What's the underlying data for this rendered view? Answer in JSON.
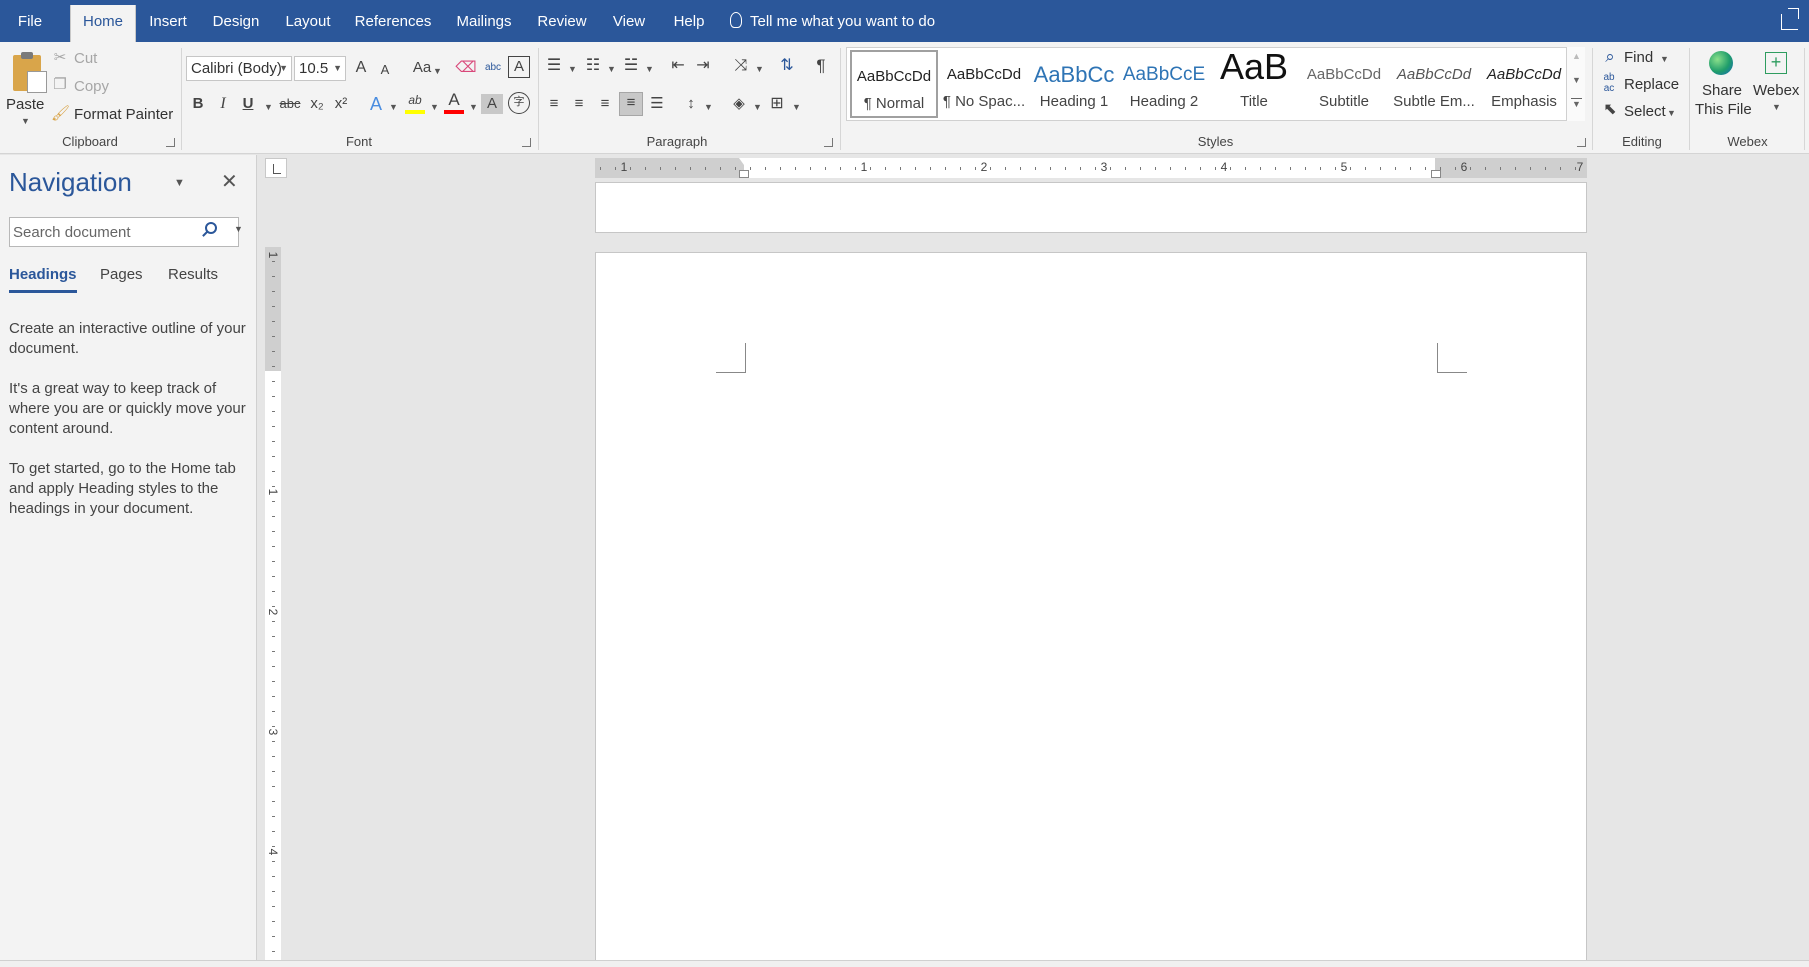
{
  "tabs": [
    "File",
    "Home",
    "Insert",
    "Design",
    "Layout",
    "References",
    "Mailings",
    "Review",
    "View",
    "Help"
  ],
  "active_tab": "Home",
  "tell_me": "Tell me what you want to do",
  "clipboard": {
    "paste": "Paste",
    "cut": "Cut",
    "copy": "Copy",
    "format_painter": "Format Painter",
    "label": "Clipboard"
  },
  "font": {
    "name": "Calibri (Body)",
    "size": "10.5",
    "label": "Font",
    "bold": "B",
    "italic": "I",
    "underline": "U",
    "strike": "abc",
    "sub": "x₂",
    "sup": "x²",
    "grow": "A",
    "shrink": "A",
    "change_case": "Aa",
    "effects": "A",
    "highlight": "ab",
    "font_color": "A",
    "shading": "A",
    "enclose": "字",
    "phonetic": "abc",
    "char_border": "A"
  },
  "paragraph": {
    "label": "Paragraph",
    "show_marks": "¶"
  },
  "styles": {
    "label": "Styles",
    "items": [
      {
        "preview": "AaBbCcDd",
        "name": "¶ Normal"
      },
      {
        "preview": "AaBbCcDd",
        "name": "¶ No Spac..."
      },
      {
        "preview": "AaBbCc",
        "name": "Heading 1"
      },
      {
        "preview": "AaBbCcE",
        "name": "Heading 2"
      },
      {
        "preview": "AaB",
        "name": "Title"
      },
      {
        "preview": "AaBbCcDd",
        "name": "Subtitle"
      },
      {
        "preview": "AaBbCcDd",
        "name": "Subtle Em..."
      },
      {
        "preview": "AaBbCcDd",
        "name": "Emphasis"
      }
    ]
  },
  "editing": {
    "find": "Find",
    "replace": "Replace",
    "select": "Select",
    "label": "Editing"
  },
  "webex": {
    "share_line1": "Share",
    "share_line2": "This File",
    "webex": "Webex",
    "label": "Webex"
  },
  "navigation": {
    "title": "Navigation",
    "search_placeholder": "Search document",
    "tabs": [
      "Headings",
      "Pages",
      "Results"
    ],
    "active_tab": "Headings",
    "paragraphs": [
      "Create an interactive outline of your document.",
      "It's a great way to keep track of where you are or quickly move your content around.",
      "To get started, go to the Home tab and apply Heading styles to the headings in your document."
    ]
  },
  "ruler": {
    "h_numbers": [
      "1",
      "1",
      "2",
      "3",
      "4",
      "5",
      "6",
      "7"
    ],
    "v_numbers": [
      "1",
      "1",
      "2",
      "3",
      "4"
    ]
  },
  "colors": {
    "brand": "#2b579a",
    "highlight": "#ffff00",
    "font_color": "#ff0000"
  }
}
